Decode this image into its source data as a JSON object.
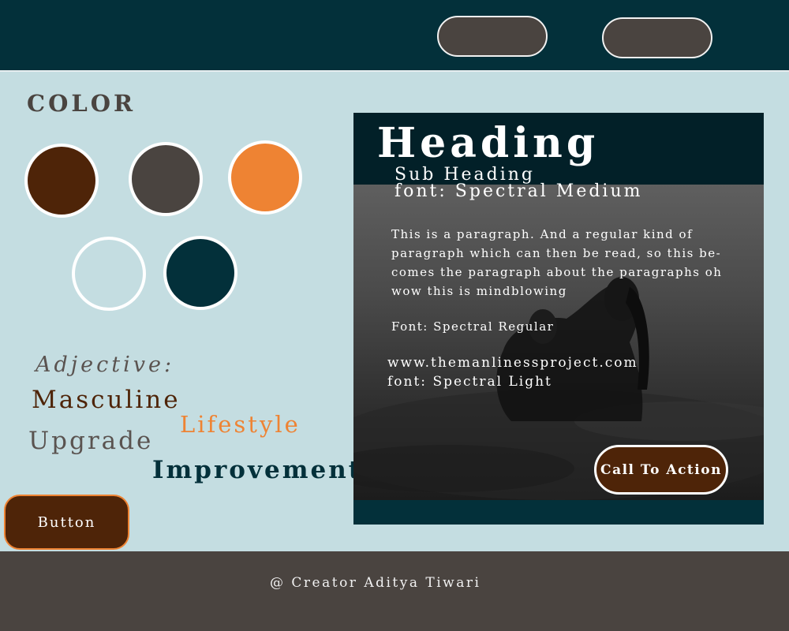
{
  "colors": {
    "accent_brown": "#4e2408",
    "charcoal": "#4a4440",
    "orange": "#ee8333",
    "light_blue": "#c4dde1",
    "dark_teal": "#03303a"
  },
  "palette": {
    "title": "COLOR",
    "swatches": [
      "#4e2408",
      "#4a4440",
      "#ee8333",
      "#c4dde1",
      "#03303a"
    ]
  },
  "adjectives": {
    "title": "Adjective:",
    "words": [
      "Masculine",
      "Upgrade",
      "Lifestyle",
      "Improvement"
    ]
  },
  "button": {
    "label": "Button"
  },
  "card": {
    "heading": "Heading",
    "sub_heading_line1": "Sub Heading",
    "sub_heading_line2": "font: Spectral Medium",
    "paragraph": "This is a paragraph. And a regular kind of paragraph which can then be read, so this be-comes the paragraph about the paragraphs oh wow this is mindblowing",
    "font_regular": "Font: Spectral Regular",
    "url": "www.themanlinessproject.com",
    "font_light": "font: Spectral Light",
    "cta_label": "Call To Action"
  },
  "footer": {
    "text": "@ Creator Aditya Tiwari"
  }
}
